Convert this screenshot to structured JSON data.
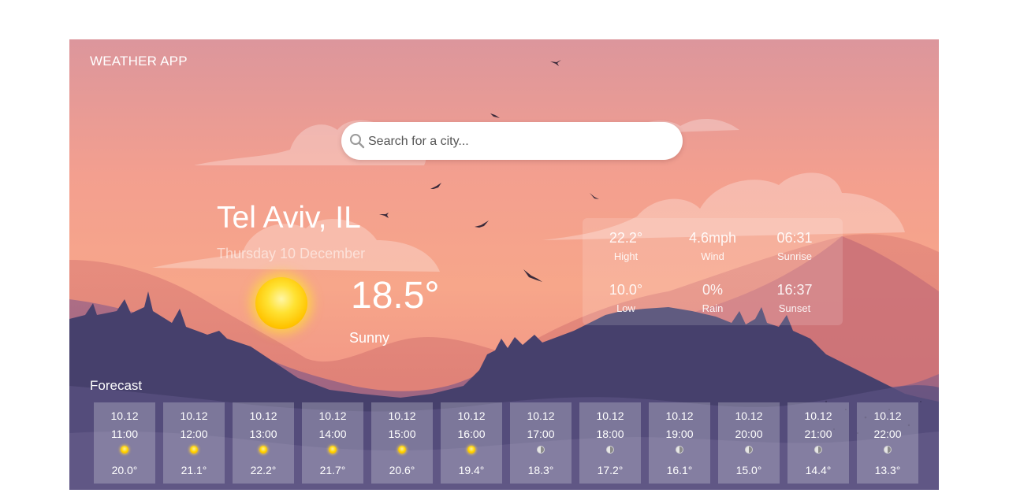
{
  "app": {
    "title": "WEATHER APP"
  },
  "search": {
    "placeholder": "Search for a city...",
    "icon": "search-icon"
  },
  "current": {
    "city": "Tel Aviv, IL",
    "date": "Thursday 10 December",
    "temperature": "18.5°",
    "condition": "Sunny",
    "icon": "sun-icon"
  },
  "details": [
    {
      "name": "high",
      "value": "22.2°",
      "label": "Hight"
    },
    {
      "name": "wind",
      "value": "4.6mph",
      "label": "Wind"
    },
    {
      "name": "sunrise",
      "value": "06:31",
      "label": "Sunrise"
    },
    {
      "name": "low",
      "value": "10.0°",
      "label": "Low"
    },
    {
      "name": "rain",
      "value": "0%",
      "label": "Rain"
    },
    {
      "name": "sunset",
      "value": "16:37",
      "label": "Sunset"
    }
  ],
  "forecast": {
    "label": "Forecast",
    "items": [
      {
        "date": "10.12",
        "time": "11:00",
        "icon": "sun-icon",
        "temp": "20.0°"
      },
      {
        "date": "10.12",
        "time": "12:00",
        "icon": "sun-icon",
        "temp": "21.1°"
      },
      {
        "date": "10.12",
        "time": "13:00",
        "icon": "sun-icon",
        "temp": "22.2°"
      },
      {
        "date": "10.12",
        "time": "14:00",
        "icon": "sun-icon",
        "temp": "21.7°"
      },
      {
        "date": "10.12",
        "time": "15:00",
        "icon": "sun-icon",
        "temp": "20.6°"
      },
      {
        "date": "10.12",
        "time": "16:00",
        "icon": "sun-icon",
        "temp": "19.4°"
      },
      {
        "date": "10.12",
        "time": "17:00",
        "icon": "moon-icon",
        "temp": "18.3°"
      },
      {
        "date": "10.12",
        "time": "18:00",
        "icon": "moon-icon",
        "temp": "17.2°"
      },
      {
        "date": "10.12",
        "time": "19:00",
        "icon": "moon-icon",
        "temp": "16.1°"
      },
      {
        "date": "10.12",
        "time": "20:00",
        "icon": "moon-icon",
        "temp": "15.0°"
      },
      {
        "date": "10.12",
        "time": "21:00",
        "icon": "moon-icon",
        "temp": "14.4°"
      },
      {
        "date": "10.12",
        "time": "22:00",
        "icon": "moon-icon",
        "temp": "13.3°"
      }
    ]
  },
  "colors": {
    "sky_top": "#d9949c",
    "sky_mid": "#f6a48a",
    "mountain_dark": "#3f3a66",
    "accent_sun": "#ffd400"
  }
}
